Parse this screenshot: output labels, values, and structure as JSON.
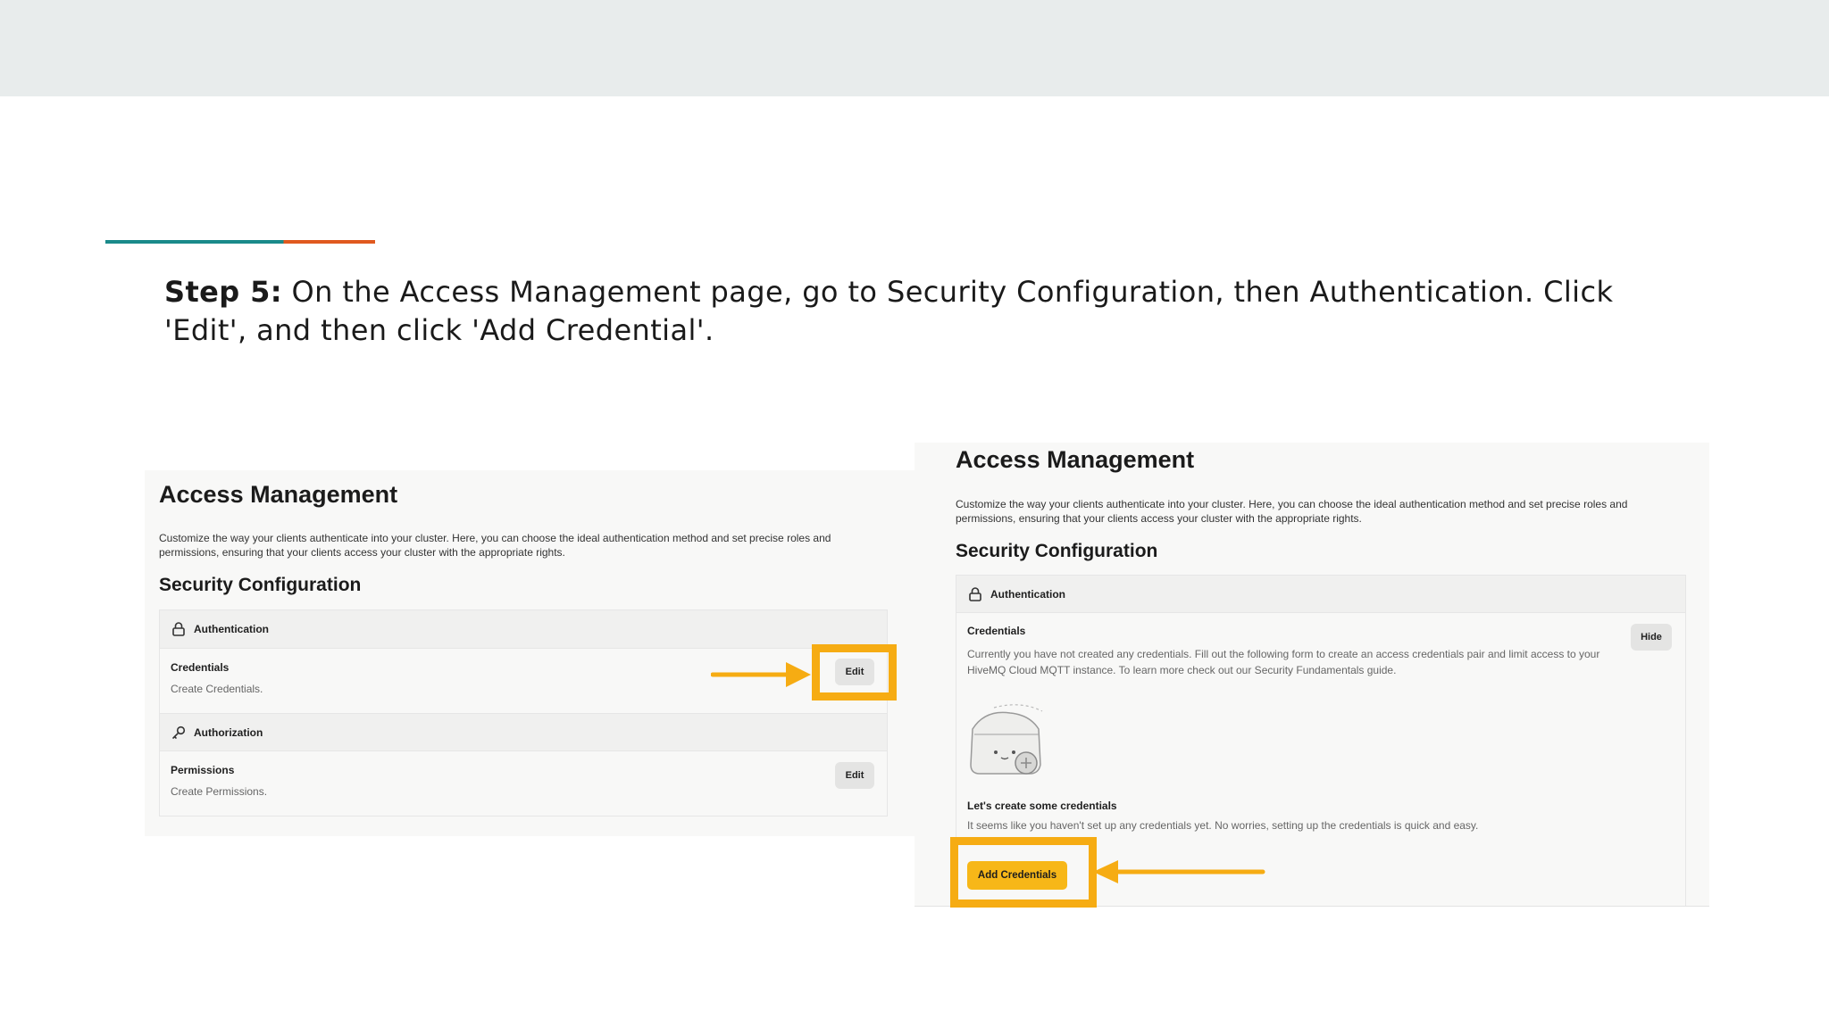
{
  "instruction": {
    "step_label": "Step 5:",
    "text": " On the Access Management page, go to Security Configuration, then Authentication. Click 'Edit', and then click 'Add Credential'."
  },
  "left_screenshot": {
    "title": "Access Management",
    "description": "Customize the way your clients authenticate into your cluster. Here, you can choose the ideal authentication method and set precise roles and permissions, ensuring that your clients access your cluster with the appropriate rights.",
    "section_title": "Security Configuration",
    "authentication": {
      "header": "Authentication",
      "item_label": "Credentials",
      "item_sub": "Create Credentials.",
      "edit_label": "Edit"
    },
    "authorization": {
      "header": "Authorization",
      "item_label": "Permissions",
      "item_sub": "Create Permissions.",
      "edit_label": "Edit"
    }
  },
  "right_screenshot": {
    "title": "Access Management",
    "description": "Customize the way your clients authenticate into your cluster. Here, you can choose the ideal authentication method and set precise roles and permissions, ensuring that your clients access your cluster with the appropriate rights.",
    "section_title": "Security Configuration",
    "authentication_header": "Authentication",
    "credentials_label": "Credentials",
    "credentials_text": "Currently you have not created any credentials. Fill out the following form to create an access credentials pair and limit access to your HiveMQ Cloud MQTT instance. To learn more check out our Security Fundamentals guide.",
    "hide_label": "Hide",
    "empty_title": "Let's create some credentials",
    "empty_text": "It seems like you haven't set up any credentials yet. No worries, setting up the credentials is quick and easy.",
    "add_button_label": "Add Credentials"
  },
  "colors": {
    "highlight": "#f6ac13",
    "add_button": "#f7b718",
    "accent_teal": "#1a8a8a",
    "accent_orange": "#e0591f"
  },
  "icons": [
    "lock-icon",
    "key-icon",
    "folder-illustration-icon",
    "arrow-icon"
  ]
}
